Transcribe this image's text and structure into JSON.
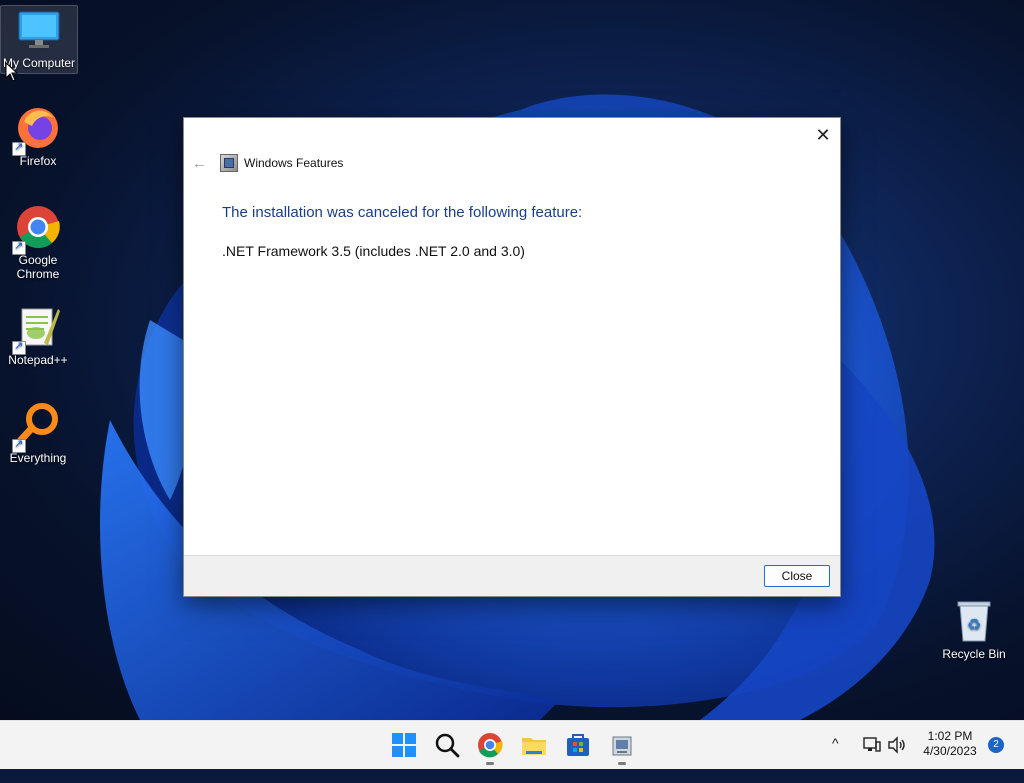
{
  "desktop": {
    "icons": [
      {
        "label": "My Computer",
        "icon": "monitor-icon"
      },
      {
        "label": "Firefox",
        "icon": "firefox-icon"
      },
      {
        "label": "Google Chrome",
        "icon": "chrome-icon"
      },
      {
        "label": "Notepad++",
        "icon": "notepadpp-icon"
      },
      {
        "label": "Everything",
        "icon": "everything-icon"
      },
      {
        "label": "Recycle Bin",
        "icon": "recycle-bin-icon"
      }
    ]
  },
  "dialog": {
    "title": "Windows Features",
    "headline": "The installation was canceled for the following feature:",
    "feature": ".NET Framework 3.5 (includes .NET 2.0 and 3.0)",
    "close_button": "Close",
    "close_glyph": "✕",
    "back_glyph": "←"
  },
  "taskbar": {
    "apps": [
      "start-icon",
      "search-icon",
      "chrome-icon",
      "file-explorer-icon",
      "store-icon",
      "windows-features-icon"
    ],
    "tray": {
      "chevron": "^",
      "time": "1:02 PM",
      "date": "4/30/2023",
      "notification_count": "2"
    }
  },
  "colors": {
    "accent": "#1e63c6",
    "headline": "#1a3e8a"
  }
}
